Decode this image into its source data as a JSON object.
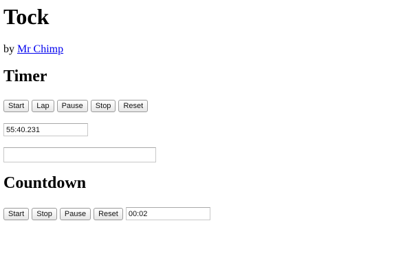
{
  "title": "Tock",
  "byline": {
    "prefix": "by ",
    "author_link": "Mr Chimp"
  },
  "timer": {
    "heading": "Timer",
    "buttons": {
      "start": "Start",
      "lap": "Lap",
      "pause": "Pause",
      "stop": "Stop",
      "reset": "Reset"
    },
    "display_value": "55:40.231",
    "lap_value": ""
  },
  "countdown": {
    "heading": "Countdown",
    "buttons": {
      "start": "Start",
      "stop": "Stop",
      "pause": "Pause",
      "reset": "Reset"
    },
    "input_value": "00:02"
  }
}
